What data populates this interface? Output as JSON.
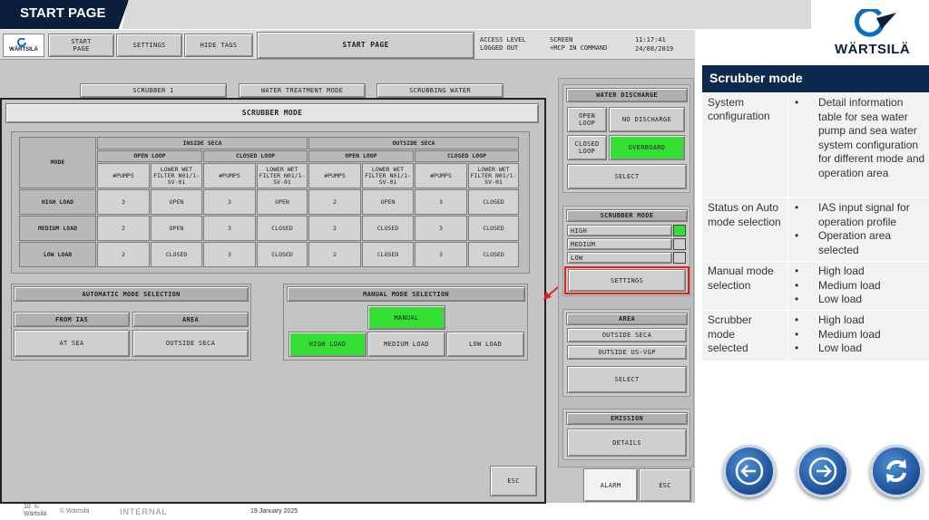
{
  "slide_title": "START PAGE",
  "brand": "WÄRTSILÄ",
  "nav": {
    "start_page": "START PAGE",
    "settings": "SETTINGS",
    "hide_tags": "HIDE TAGS",
    "page_title": "START PAGE",
    "access_level": "ACCESS LEVEL",
    "access_status": "LOGGED OUT",
    "screen_label": "SCREEN",
    "screen_status": "+MCP IN COMMAND",
    "time": "11:17:41",
    "date": "24/08/2019"
  },
  "background_tabs": [
    "SCRUBBER 1",
    "WATER TREATMENT MODE",
    "SCRUBBING WATER"
  ],
  "dialog": {
    "title": "SCRUBBER MODE",
    "table": {
      "mode_header": "MODE",
      "groups": [
        "INSIDE SECA",
        "OUTSIDE SECA"
      ],
      "loops": [
        "OPEN LOOP",
        "CLOSED LOOP",
        "OPEN LOOP",
        "CLOSED LOOP"
      ],
      "col_pumps": "#PUMPS",
      "col_filter": "LOWER WET FILTER N01/1-SV-01",
      "rows": [
        {
          "mode": "HIGH LOAD",
          "values": [
            "3",
            "OPEN",
            "3",
            "OPEN",
            "2",
            "OPEN",
            "3",
            "CLOSED"
          ]
        },
        {
          "mode": "MEDIUM LOAD",
          "values": [
            "2",
            "OPEN",
            "3",
            "CLOSED",
            "2",
            "CLOSED",
            "3",
            "CLOSED"
          ]
        },
        {
          "mode": "LOW LOAD",
          "values": [
            "2",
            "CLOSED",
            "3",
            "CLOSED",
            "2",
            "CLOSED",
            "3",
            "CLOSED"
          ]
        }
      ]
    },
    "auto": {
      "title": "AUTOMATIC MODE SELECTION",
      "from_ias": "FROM IAS",
      "area": "AREA",
      "from_ias_value": "AT SEA",
      "area_value": "OUTSIDE SECA"
    },
    "manual": {
      "title": "MANUAL MODE SELECTION",
      "manual": "MANUAL",
      "high": "HIGH LOAD",
      "medium": "MEDIUM LOAD",
      "low": "LOW LOAD"
    },
    "esc": "ESC"
  },
  "right_panel": {
    "water_discharge_title": "WATER DISCHARGE",
    "open_loop": "OPEN LOOP",
    "no_discharge": "NO DISCHARGE",
    "closed_loop": "CLOSED LOOP",
    "overboard": "OVERBOARD",
    "select": "SELECT",
    "scrubber_mode_title": "SCRUBBER MODE",
    "modes": [
      "HIGH",
      "MEDIUM",
      "LOW"
    ],
    "settings": "SETTINGS",
    "area_title": "AREA",
    "areas": [
      "OUTSIDE SECA",
      "OUTSIDE US-VGP"
    ],
    "area_select": "SELECT",
    "emission_title": "EMISSION",
    "details": "DETAILS",
    "alarm": "ALARM",
    "esc": "ESC"
  },
  "info": {
    "title": "Scrubber mode",
    "rows": [
      {
        "label": "System configuration",
        "bullets": [
          "Detail information table for sea water pump and sea water system configuration for different mode and operation area"
        ]
      },
      {
        "label": "Status on Auto mode selection",
        "bullets": [
          "IAS input signal for operation profile",
          "Operation area selected"
        ]
      },
      {
        "label": "Manual mode selection",
        "bullets": [
          "High load",
          "Medium load",
          "Low load"
        ]
      },
      {
        "label": "Scrubber mode selected",
        "bullets": [
          "High load",
          "Medium load",
          "Low load"
        ]
      }
    ]
  },
  "footer": {
    "page": "10",
    "copyright_symbol": "©",
    "company": "Wärtsilä",
    "copyright": "© Wärtsilä",
    "classification": "INTERNAL",
    "date": "19 January 2025"
  },
  "colors": {
    "title_bar": "#0b1f3c",
    "info_header": "#0d2a4e",
    "accent_green": "#33e033",
    "alarm_red": "#e02020"
  }
}
